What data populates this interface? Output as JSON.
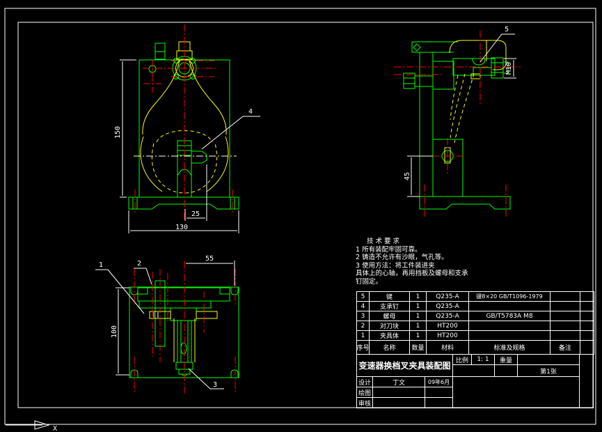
{
  "frame": {
    "axis_label": "X"
  },
  "tech_req": {
    "title": "技 术 要 求",
    "l1": "1  所有装配牢固可靠。",
    "l2": "2  铸造不允许有沙眼，气孔等。",
    "l3": "3  使用方法：将工件装进夹",
    "l4": "具体上的心轴，再用挡板及螺母和支承",
    "l5": "钉固定。"
  },
  "parts": {
    "header": [
      "序号",
      "名称",
      "数量",
      "材料",
      "标准及规格",
      "备注"
    ],
    "rows": [
      [
        "5",
        "键",
        "1",
        "Q235-A",
        "键8×20 GB/T1096-1979",
        ""
      ],
      [
        "4",
        "支承钉",
        "1",
        "Q235-A",
        "",
        ""
      ],
      [
        "3",
        "螺母",
        "1",
        "Q235-A",
        "GB/T5783A M8",
        ""
      ],
      [
        "2",
        "对刀块",
        "1",
        "HT200",
        "",
        ""
      ],
      [
        "1",
        "夹具体",
        "1",
        "HT200",
        "",
        ""
      ]
    ]
  },
  "title_block": {
    "title": "变速器换档叉夹具装配图",
    "scale_label": "比例",
    "scale_value": "1: 1",
    "weight_label": "重量",
    "sheet_no": "第1张",
    "design_label": "设计",
    "designer": "丁文",
    "date": "09年6月",
    "draft_label": "绘图",
    "audit_label": "审核"
  },
  "dims": {
    "front_height": "150",
    "front_slot": "25",
    "front_width": "130",
    "plan_width": "55",
    "plan_height": "100",
    "side_height": "45",
    "side_thread": "M10"
  },
  "leaders": {
    "n1": "1",
    "n2": "2",
    "n3": "3",
    "n4": "4",
    "n5": "5"
  },
  "colors": {
    "outline": "#00ff00",
    "auxiliary": "#ffff00",
    "centerline": "#ff0000",
    "annotation": "#ffffff",
    "background": "#000000"
  }
}
